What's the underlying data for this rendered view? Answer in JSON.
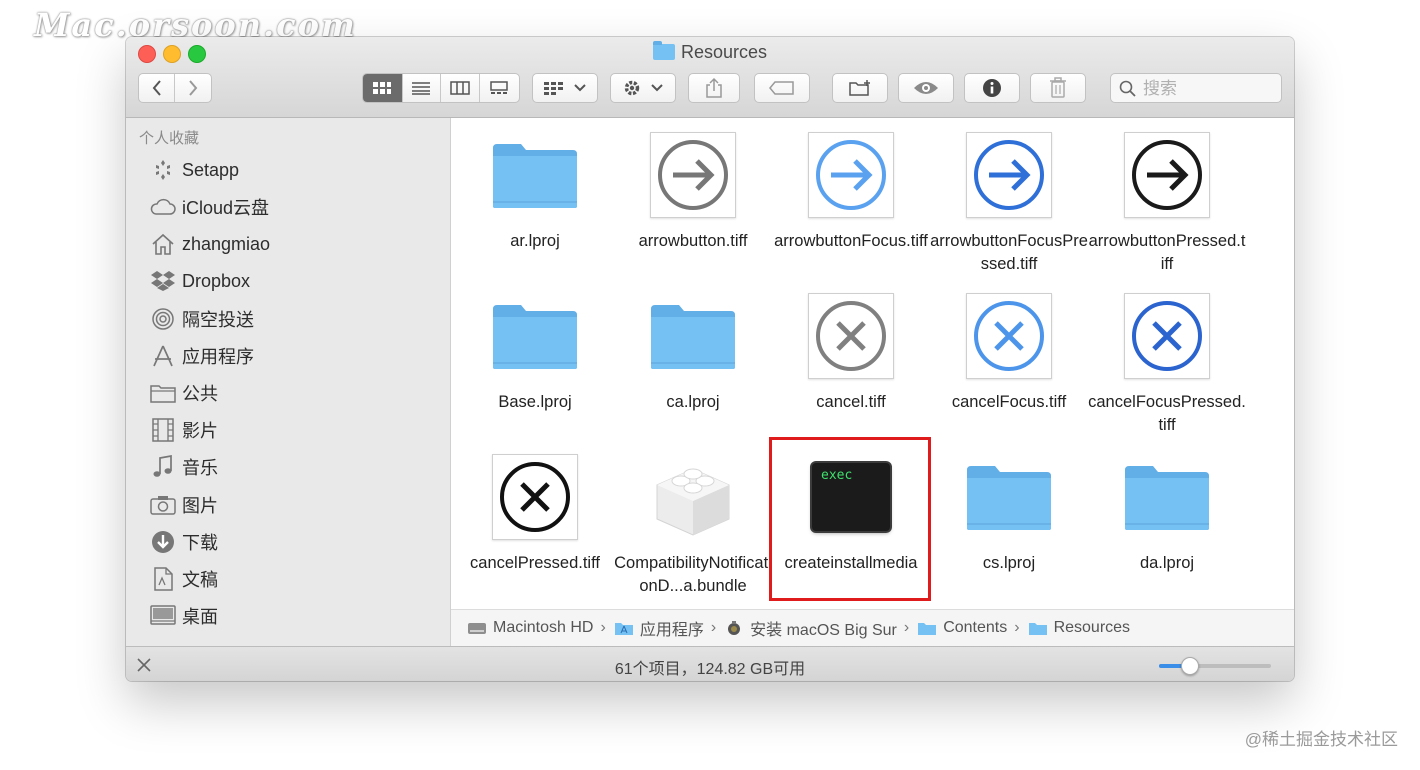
{
  "watermark_top": "Mac.orsoon.com",
  "watermark_bottom": "@稀土掘金技术社区",
  "window": {
    "title": "Resources",
    "search_placeholder": "搜索"
  },
  "sidebar": {
    "heading": "个人收藏",
    "items": [
      {
        "label": "Setapp",
        "icon": "setapp-icon"
      },
      {
        "label": "iCloud云盘",
        "icon": "cloud-icon"
      },
      {
        "label": "zhangmiao",
        "icon": "home-icon"
      },
      {
        "label": "Dropbox",
        "icon": "dropbox-icon"
      },
      {
        "label": "隔空投送",
        "icon": "airdrop-icon"
      },
      {
        "label": "应用程序",
        "icon": "applications-icon"
      },
      {
        "label": "公共",
        "icon": "folder-icon"
      },
      {
        "label": "影片",
        "icon": "film-icon"
      },
      {
        "label": "音乐",
        "icon": "music-icon"
      },
      {
        "label": "图片",
        "icon": "camera-icon"
      },
      {
        "label": "下载",
        "icon": "download-icon"
      },
      {
        "label": "文稿",
        "icon": "document-icon"
      },
      {
        "label": "桌面",
        "icon": "desktop-icon"
      }
    ]
  },
  "files": [
    {
      "name": "ar.lproj",
      "kind": "folder"
    },
    {
      "name": "arrowbutton.tiff",
      "kind": "arrow-gray"
    },
    {
      "name": "arrowbuttonFocus.tiff",
      "kind": "arrow-blue-light"
    },
    {
      "name": "arrowbuttonFocusPressed.tiff",
      "kind": "arrow-blue"
    },
    {
      "name": "arrowbuttonPressed.tiff",
      "kind": "arrow-black"
    },
    {
      "name": "Base.lproj",
      "kind": "folder"
    },
    {
      "name": "ca.lproj",
      "kind": "folder"
    },
    {
      "name": "cancel.tiff",
      "kind": "x-gray"
    },
    {
      "name": "cancelFocus.tiff",
      "kind": "x-blue-light"
    },
    {
      "name": "cancelFocusPressed.tiff",
      "kind": "x-blue"
    },
    {
      "name": "cancelPressed.tiff",
      "kind": "x-black"
    },
    {
      "name": "CompatibilityNotificationD...a.bundle",
      "kind": "bundle"
    },
    {
      "name": "createinstallmedia",
      "kind": "exec",
      "exec_label": "exec",
      "selected": true
    },
    {
      "name": "cs.lproj",
      "kind": "folder"
    },
    {
      "name": "da.lproj",
      "kind": "folder"
    }
  ],
  "pathbar": [
    {
      "label": "Macintosh HD",
      "icon": "hard-drive-icon"
    },
    {
      "label": "应用程序",
      "icon": "applications-folder-icon"
    },
    {
      "label": "安装 macOS Big Sur",
      "icon": "installer-icon"
    },
    {
      "label": "Contents",
      "icon": "folder-icon"
    },
    {
      "label": "Resources",
      "icon": "folder-icon"
    }
  ],
  "status": {
    "text": "61个项目，124.82 GB可用",
    "zoom_level": 0.27
  },
  "colors": {
    "folder": "#75c1f4",
    "selection": "#e01b1b",
    "accent": "#3a8ee8"
  }
}
